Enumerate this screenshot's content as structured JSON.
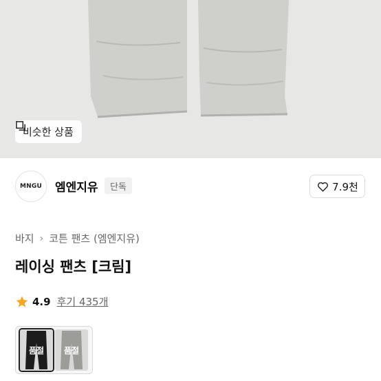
{
  "hero": {
    "similar_button_label": "비슷한 상품",
    "similar_icon": "similar-items-icon"
  },
  "brand": {
    "logo_text": "MNGU",
    "name": "엠엔지유",
    "tag": "단독",
    "likes": "7.9천",
    "like_icon": "heart-outline-icon"
  },
  "breadcrumb": {
    "items": [
      "바지",
      "코튼 팬츠 (엠엔지유)"
    ],
    "separator_icon": "chevron-right-icon"
  },
  "product": {
    "title": "레이싱 팬츠 [크림]",
    "rating": "4.9",
    "reviews": "후기 435개",
    "star_color": "#f5a623"
  },
  "options": [
    {
      "status": "품절",
      "color_swatch": "#1c1c1c"
    },
    {
      "status": "품절",
      "color_swatch": "#9c9c98"
    }
  ]
}
